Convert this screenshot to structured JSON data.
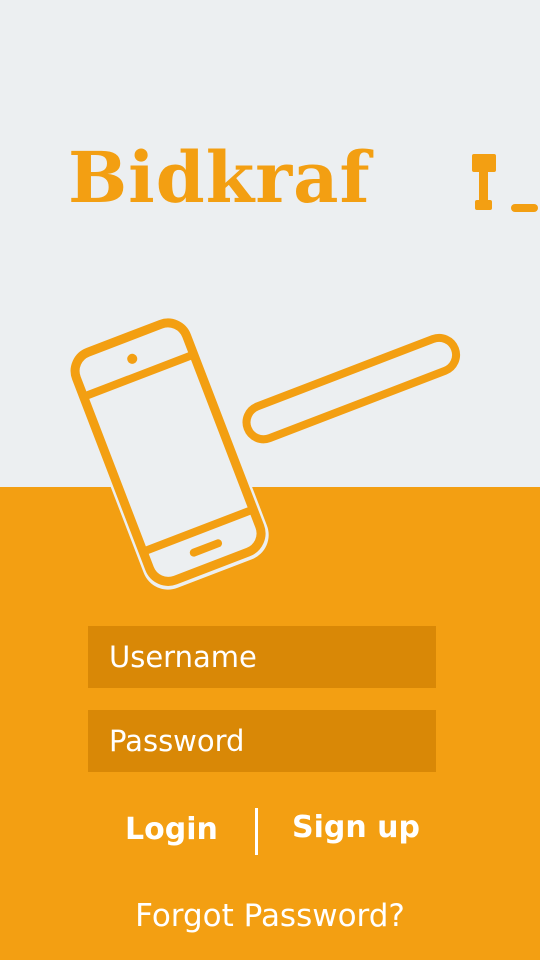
{
  "brand": {
    "name": "Bidkraf",
    "logo_icon": "gavel-icon",
    "accent_color": "#f39f12"
  },
  "hero": {
    "icon": "phone-gavel-icon"
  },
  "form": {
    "username_placeholder": "Username",
    "password_placeholder": "Password"
  },
  "actions": {
    "login_label": "Login",
    "signup_label": "Sign up",
    "forgot_label": "Forgot Password?"
  }
}
